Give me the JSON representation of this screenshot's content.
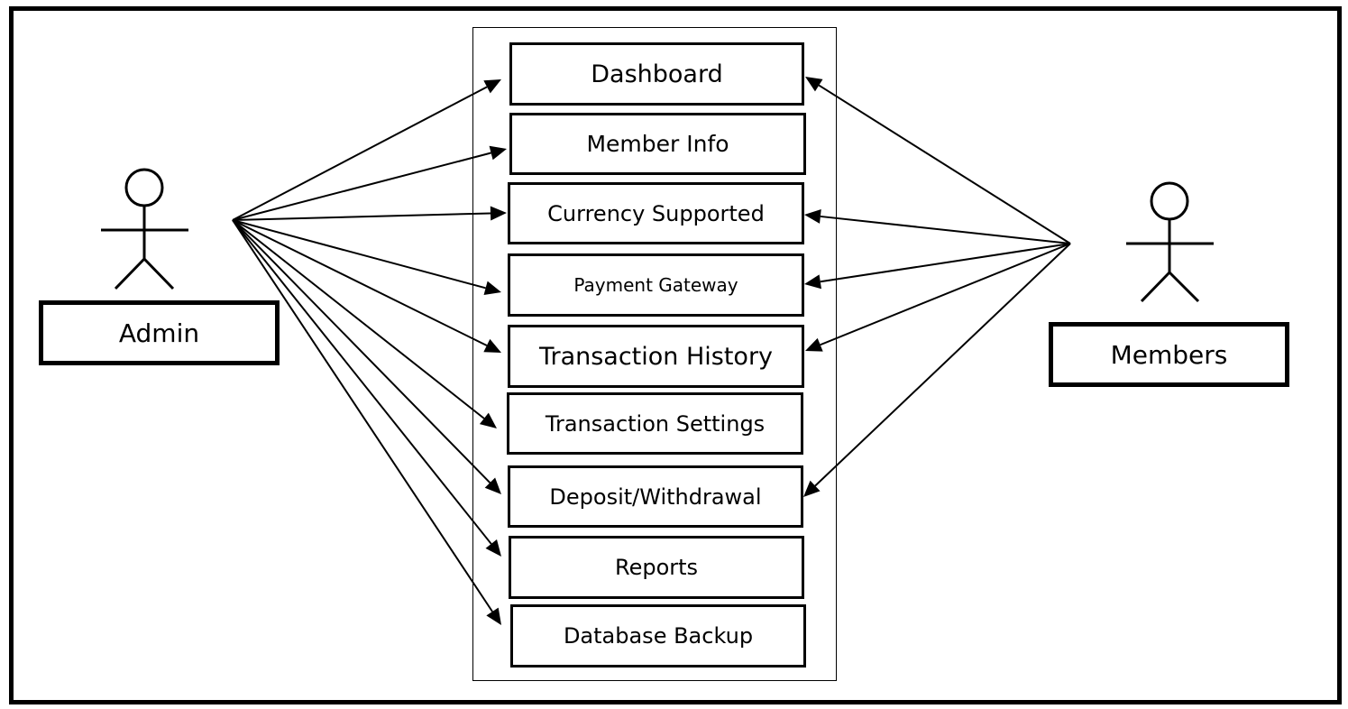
{
  "diagram": {
    "type": "use-case",
    "actors": [
      {
        "id": "admin",
        "label": "Admin"
      },
      {
        "id": "members",
        "label": "Members"
      }
    ],
    "use_cases": [
      {
        "id": "dashboard",
        "label": "Dashboard"
      },
      {
        "id": "member-info",
        "label": "Member Info"
      },
      {
        "id": "currency-supported",
        "label": "Currency Supported"
      },
      {
        "id": "payment-gateway",
        "label": "Payment Gateway"
      },
      {
        "id": "transaction-history",
        "label": "Transaction History"
      },
      {
        "id": "transaction-settings",
        "label": "Transaction Settings"
      },
      {
        "id": "deposit-withdrawal",
        "label": "Deposit/Withdrawal"
      },
      {
        "id": "reports",
        "label": "Reports"
      },
      {
        "id": "database-backup",
        "label": "Database Backup"
      }
    ],
    "associations": [
      {
        "from": "admin",
        "to": "dashboard"
      },
      {
        "from": "admin",
        "to": "member-info"
      },
      {
        "from": "admin",
        "to": "currency-supported"
      },
      {
        "from": "admin",
        "to": "payment-gateway"
      },
      {
        "from": "admin",
        "to": "transaction-history"
      },
      {
        "from": "admin",
        "to": "transaction-settings"
      },
      {
        "from": "admin",
        "to": "deposit-withdrawal"
      },
      {
        "from": "admin",
        "to": "reports"
      },
      {
        "from": "admin",
        "to": "database-backup"
      },
      {
        "from": "members",
        "to": "dashboard"
      },
      {
        "from": "members",
        "to": "currency-supported"
      },
      {
        "from": "members",
        "to": "payment-gateway"
      },
      {
        "from": "members",
        "to": "transaction-history"
      },
      {
        "from": "members",
        "to": "deposit-withdrawal"
      }
    ],
    "colors": {
      "stroke": "#000000",
      "background": "#ffffff"
    }
  }
}
